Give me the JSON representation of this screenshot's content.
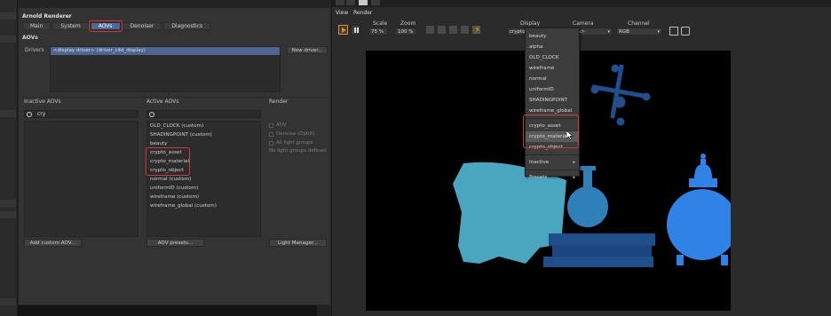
{
  "panel": {
    "title": "Arnold Renderer",
    "tabs": [
      "Main",
      "System",
      "AOVs",
      "Denoiser",
      "Diagnostics"
    ],
    "section": "AOVs",
    "drivers_label": "Drivers",
    "driver_row": "<display driver> (driver_c4d_display)",
    "new_driver_label": "New driver..."
  },
  "inactive": {
    "title": "Inactive AOVs",
    "search_value": "cry"
  },
  "active": {
    "title": "Active AOVs",
    "items": [
      "OLD_CLOCK (custom)",
      "SHADINGPOINT (custom)",
      "beauty",
      "crypto_asset",
      "crypto_material",
      "crypto_object",
      "normal (custom)",
      "uniformID (custom)",
      "wireframe (custom)",
      "wireframe_global (custom)"
    ]
  },
  "render": {
    "title": "Render",
    "checks": [
      "AOV",
      "Denoise (OptiX)",
      "All light groups"
    ],
    "no_light": "No light groups defined"
  },
  "buttons": {
    "add_custom": "Add custom AOV...",
    "aov_presets": "AOV presets...",
    "light_manager": "Light Manager..."
  },
  "viewer": {
    "menu": [
      "View",
      "Render"
    ],
    "scale_label": "Scale",
    "scale_value": "75 %",
    "zoom_label": "Zoom",
    "zoom_value": "100 %",
    "display_label": "Display",
    "display_value": "crypto",
    "camera_label": "Camera",
    "camera_value": "<camera>",
    "channel_label": "Channel",
    "channel_value": "RGB"
  },
  "dropdown": {
    "items": [
      "beauty",
      "alpha",
      "OLD_CLOCK",
      "wireframe",
      "normal",
      "uniformID",
      "SHADINGPOINT",
      "wireframe_global"
    ],
    "crypto_items": [
      "crypto_asset",
      "crypto_material",
      "crypto_object"
    ],
    "inactive_label": "Inactive",
    "presets_label": "Presets"
  },
  "colors": {
    "accent_blue": "#4b6a9a",
    "highlight_red": "#d23a3a",
    "play_orange": "#e48a2a"
  }
}
